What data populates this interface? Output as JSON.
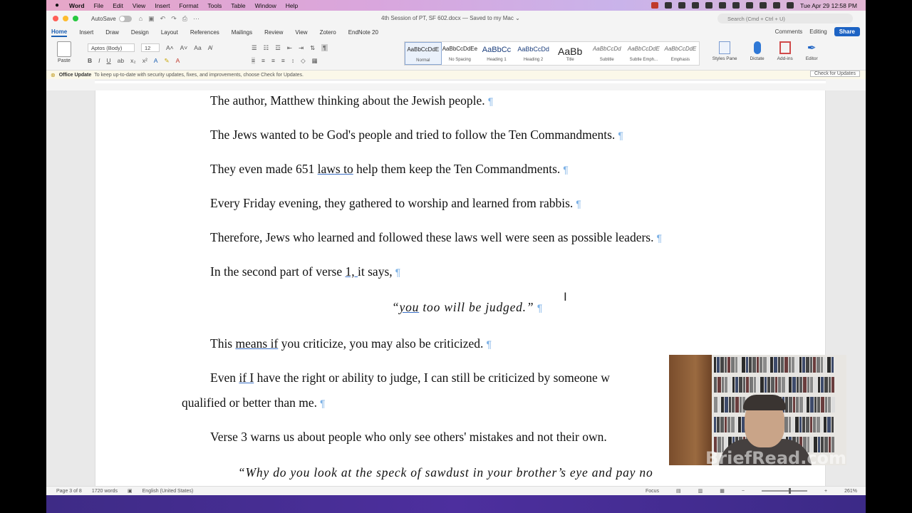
{
  "menubar": {
    "app": "Word",
    "items": [
      "File",
      "Edit",
      "View",
      "Insert",
      "Format",
      "Tools",
      "Table",
      "Window",
      "Help"
    ],
    "clock": "Tue Apr 29  12:58 PM"
  },
  "titlebar": {
    "autosave": "AutoSave",
    "doc_title": "4th Session of PT, SF 602.docx — Saved to my Mac ⌄",
    "search_placeholder": "Search (Cmd + Ctrl + U)"
  },
  "tabs": {
    "items": [
      "Home",
      "Insert",
      "Draw",
      "Design",
      "Layout",
      "References",
      "Mailings",
      "Review",
      "View",
      "Zotero",
      "EndNote 20"
    ],
    "comments": "Comments",
    "editing": "Editing",
    "share": "Share"
  },
  "ribbon": {
    "paste": "Paste",
    "font_name": "Aptos (Body)",
    "font_size": "12",
    "styles": [
      {
        "preview": "AaBbCcDdE",
        "name": "Normal"
      },
      {
        "preview": "AaBbCcDdEe",
        "name": "No Spacing"
      },
      {
        "preview": "AaBbCc",
        "name": "Heading 1"
      },
      {
        "preview": "AaBbCcDd",
        "name": "Heading 2"
      },
      {
        "preview": "AaBb",
        "name": "Title"
      },
      {
        "preview": "AaBbCcDd",
        "name": "Subtitle"
      },
      {
        "preview": "AaBbCcDdE",
        "name": "Subtle Emph..."
      },
      {
        "preview": "AaBbCcDdE",
        "name": "Emphasis"
      }
    ],
    "tools": [
      "Styles Pane",
      "Dictate",
      "Add-ins",
      "Editor"
    ]
  },
  "infobar": {
    "title": "Office Update",
    "message": "To keep up-to-date with security updates, fixes, and improvements, choose Check for Updates.",
    "button": "Check for Updates"
  },
  "document": {
    "p1": "The author, Matthew thinking about the Jewish people.",
    "p2": "The Jews wanted to be God's people and tried to follow the Ten Commandments.",
    "p3_a": "They even made 651 ",
    "p3_u": "laws to",
    "p3_b": " help them keep the Ten Commandments.",
    "p4": "Every Friday evening, they gathered to worship and learned from rabbis.",
    "p5": "Therefore, Jews who learned and followed these laws well were seen as possible leaders.",
    "p6_a": "In the second part of verse ",
    "p6_u": "1, ",
    "p6_b": "it says,",
    "quote_a": "“",
    "quote_u": "you",
    "quote_b": " too will be judged.”",
    "p7_a": "This ",
    "p7_u": "means if",
    "p7_b": " you criticize, you may also be criticized.",
    "p8_a": "Even ",
    "p8_u": "if I",
    "p8_b": " have the right or ability to judge, I can still be criticized by someone w",
    "p8_c": "qualified or better than me.",
    "p9": "Verse 3 warns us about people who only see others' mistakes and not their own.",
    "quote2": "“Why do you look at the speck of sawdust in your brother’s eye and pay no"
  },
  "statusbar": {
    "page": "Page 3 of 8",
    "words": "1720 words",
    "language": "English (United States)",
    "focus": "Focus",
    "zoom": "261%"
  },
  "watermark": "BriefRead.com"
}
